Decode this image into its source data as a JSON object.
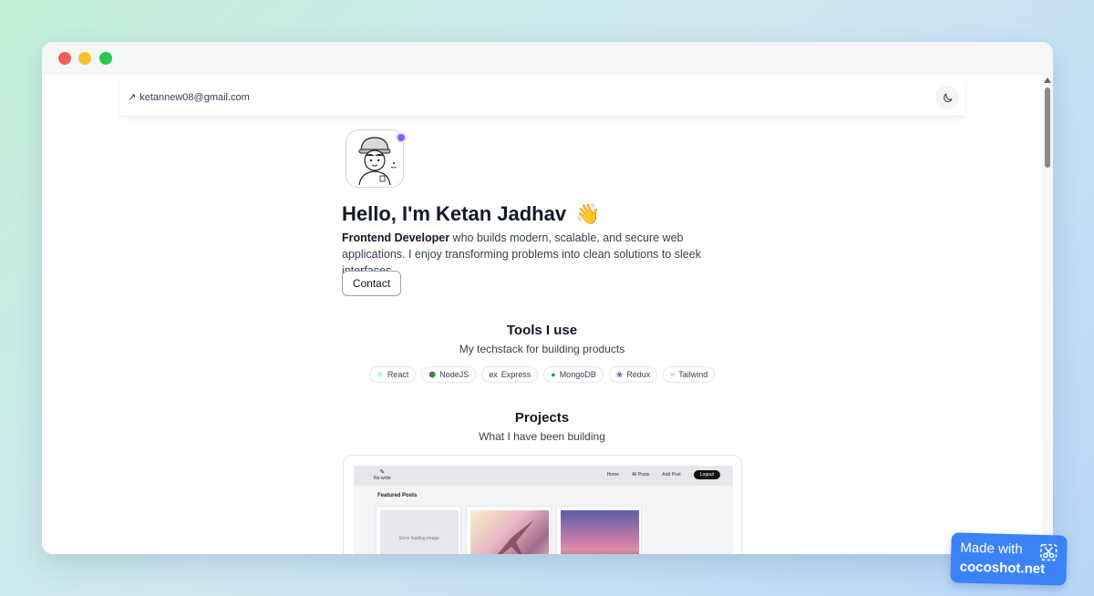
{
  "window": {
    "controls": [
      "close",
      "minimize",
      "maximize"
    ]
  },
  "navbar": {
    "email": "ketannew08@gmail.com",
    "theme_icon": "moon-icon"
  },
  "hero": {
    "greeting": "Hello, I'm Ketan Jadhav",
    "emoji": "👋",
    "role": "Frontend Developer",
    "description": " who builds modern, scalable, and secure web applications. I enjoy transforming problems into clean solutions to sleek interfaces.",
    "contact_label": "Contact"
  },
  "tools": {
    "title": "Tools I use",
    "subtitle": "My techstack for building products",
    "items": [
      {
        "label": "React",
        "icon": "react-icon",
        "color": "#61dafb"
      },
      {
        "label": "NodeJS",
        "icon": "nodejs-icon",
        "color": "#3c873a"
      },
      {
        "label": "Express",
        "icon": "express-icon",
        "color": "#333333"
      },
      {
        "label": "MongoDB",
        "icon": "mongodb-icon",
        "color": "#13aa52"
      },
      {
        "label": "Redux",
        "icon": "redux-icon",
        "color": "#764abc"
      },
      {
        "label": "Tailwind",
        "icon": "tailwind-icon",
        "color": "#38bdf8"
      }
    ]
  },
  "projects": {
    "title": "Projects",
    "subtitle": "What I have been building",
    "preview": {
      "logo_text": "Re-write",
      "menu": [
        "Home",
        "All Posts",
        "Add Post"
      ],
      "logout": "Logout",
      "featured": "Featured Posts",
      "loading_text": "Error loading image"
    }
  },
  "watermark": {
    "line1": "Made with",
    "line2": "cocoshot.net"
  },
  "colors": {
    "accent": "#8b5cf6",
    "badge": "#3b82f6"
  }
}
